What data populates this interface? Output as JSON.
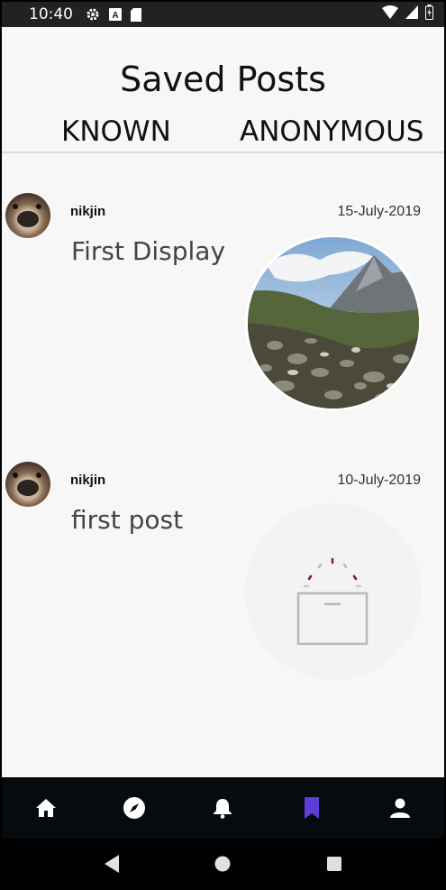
{
  "status_bar": {
    "time": "10:40",
    "icons": [
      "gear-icon",
      "a-badge-icon",
      "sd-card-icon",
      "wifi-icon",
      "signal-icon",
      "battery-icon"
    ]
  },
  "header": {
    "title": "Saved Posts",
    "tabs": [
      {
        "label": "KNOWN"
      },
      {
        "label": "ANONYMOUS"
      }
    ]
  },
  "posts": [
    {
      "username": "nikjin",
      "date": "15-July-2019",
      "text": "First Display",
      "media": "mountain-valley-photo"
    },
    {
      "username": "nikjin",
      "date": "10-July-2019",
      "text": "first post",
      "media": "image-loading"
    }
  ],
  "bottom_nav": {
    "items": [
      "home-icon",
      "explore-icon",
      "notifications-icon",
      "saved-icon",
      "profile-icon"
    ],
    "active_index": 3,
    "active_color": "#5b3fd6",
    "inactive_color": "#ffffff"
  },
  "system_nav": {
    "items": [
      "back-icon",
      "home-circle-icon",
      "recents-icon"
    ]
  }
}
